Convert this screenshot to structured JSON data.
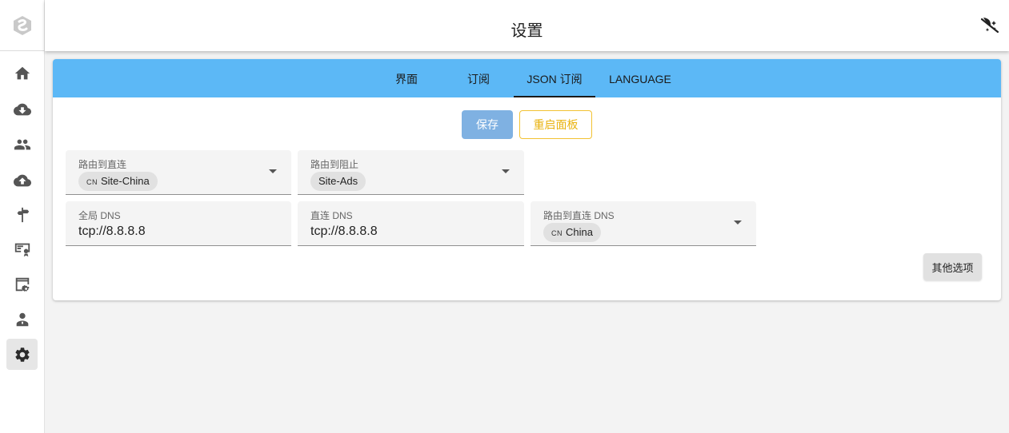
{
  "header": {
    "title": "设置"
  },
  "sidebar": {
    "items": [
      {
        "icon": "home-icon"
      },
      {
        "icon": "cloud-download-icon"
      },
      {
        "icon": "users-icon"
      },
      {
        "icon": "cloud-upload-icon"
      },
      {
        "icon": "signpost-icon"
      },
      {
        "icon": "certificate-icon"
      },
      {
        "icon": "browser-settings-icon"
      },
      {
        "icon": "admin-user-icon"
      },
      {
        "icon": "gear-icon",
        "active": true
      }
    ]
  },
  "tabs": [
    {
      "label": "界面"
    },
    {
      "label": "订阅"
    },
    {
      "label": "JSON 订阅",
      "active": true
    },
    {
      "label": "LANGUAGE"
    }
  ],
  "actions": {
    "save_label": "保存",
    "restart_label": "重启面板",
    "more_label": "其他选项"
  },
  "fields": {
    "route_direct": {
      "label": "路由到直连",
      "chip_prefix": "CN",
      "chip": "Site-China"
    },
    "route_block": {
      "label": "路由到阻止",
      "chip": "Site-Ads"
    },
    "global_dns": {
      "label": "全局 DNS",
      "value": "tcp://8.8.8.8"
    },
    "direct_dns": {
      "label": "直连 DNS",
      "value": "tcp://8.8.8.8"
    },
    "route_direct_dns": {
      "label": "路由到直连 DNS",
      "chip_prefix": "CN",
      "chip": "China"
    }
  },
  "colors": {
    "tab_bar": "#5cb8f6",
    "save_button": "#7fb1e2",
    "restart_border": "#f2c232"
  }
}
